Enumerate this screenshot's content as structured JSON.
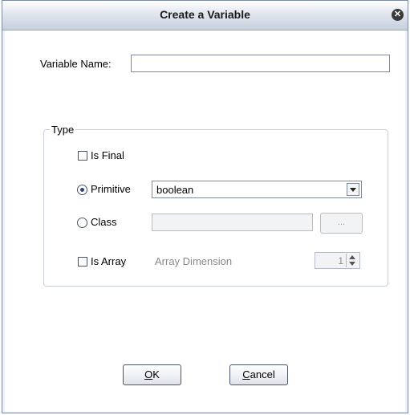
{
  "dialog": {
    "title": "Create a Variable",
    "close_icon": "close-icon"
  },
  "variable_name": {
    "label": "Variable Name:",
    "value": ""
  },
  "type_group": {
    "legend": "Type",
    "is_final": {
      "label": "Is Final",
      "checked": false
    },
    "primitive": {
      "label": "Primitive",
      "selected": true,
      "value": "boolean"
    },
    "class": {
      "label": "Class",
      "selected": false,
      "value": "",
      "browse_label": "..."
    },
    "is_array": {
      "label": "Is Array",
      "checked": false
    },
    "array_dimension": {
      "label": "Array Dimension",
      "value": "1"
    }
  },
  "buttons": {
    "ok_mnemonic": "O",
    "ok_rest": "K",
    "cancel_mnemonic": "C",
    "cancel_rest": "ancel"
  },
  "colors": {
    "accent": "#33437a",
    "title_gradient_end": "#c7cfdd"
  }
}
